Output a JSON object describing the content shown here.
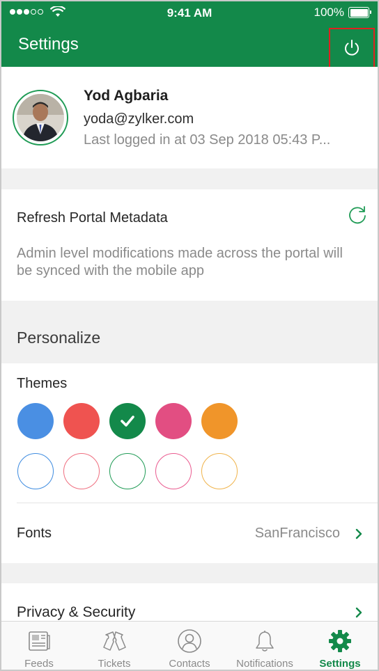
{
  "status_bar": {
    "time": "9:41 AM",
    "battery": "100%",
    "signal_icon": "signal-dots-icon",
    "wifi_icon": "wifi-icon"
  },
  "header": {
    "title": "Settings",
    "power_icon": "power-icon"
  },
  "profile": {
    "name": "Yod Agbaria",
    "email": "yoda@zylker.com",
    "last_login": "Last logged in at 03 Sep 2018 05:43 P..."
  },
  "refresh": {
    "title": "Refresh Portal Metadata",
    "description": "Admin level modifications made across the portal will be synced with the mobile app",
    "icon": "refresh-icon"
  },
  "personalize": {
    "title": "Personalize"
  },
  "themes": {
    "title": "Themes",
    "filled": [
      "#4a8fe3",
      "#ef5350",
      "#13894a",
      "#e24e82",
      "#f0952a"
    ],
    "outline": [
      "#3d8be0",
      "#ef6e7f",
      "#1f9b55",
      "#ea5a8f",
      "#f0b34a"
    ],
    "selected_index": 2
  },
  "fonts": {
    "label": "Fonts",
    "value": "SanFrancisco"
  },
  "privacy": {
    "label": "Privacy & Security"
  },
  "tabs": [
    {
      "label": "Feeds",
      "icon": "feeds-icon",
      "active": false
    },
    {
      "label": "Tickets",
      "icon": "tickets-icon",
      "active": false
    },
    {
      "label": "Contacts",
      "icon": "contacts-icon",
      "active": false
    },
    {
      "label": "Notifications",
      "icon": "bell-icon",
      "active": false
    },
    {
      "label": "Settings",
      "icon": "gear-icon",
      "active": true
    }
  ],
  "colors": {
    "brand": "#13894a",
    "tab_inactive": "#8a8a8a"
  }
}
